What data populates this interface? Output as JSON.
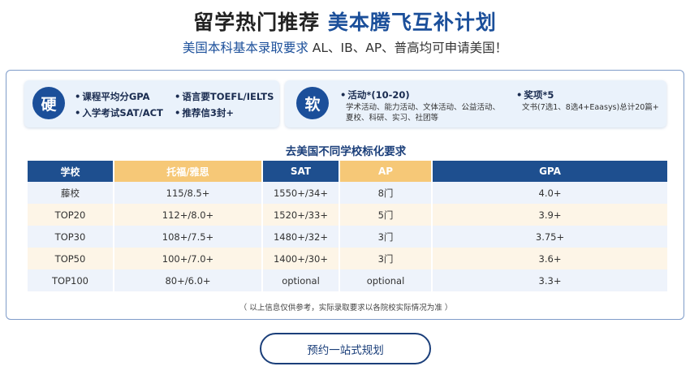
{
  "header": {
    "title_part1": "留学热门推荐",
    "title_part2": "美本腾飞互补计划",
    "subtitle_highlight": "美国本科基本录取要求",
    "subtitle_rest": " AL、IB、AP、普高均可申请美国！"
  },
  "hard": {
    "badge": "硬",
    "items": [
      "课程平均分GPA",
      "入学考试SAT/ACT",
      "语言要TOEFL/IELTS",
      "推荐信3封+"
    ]
  },
  "soft": {
    "badge": "软",
    "activity_title": "活动*(10-20)",
    "activity_line1": "学术活动、能力活动、文体活动、公益活动、",
    "activity_line2": "夏校、科研、实习、社团等",
    "award_title": "奖项*5",
    "award_detail": "文书(7选1、8选4+Eaasys)总计20篇+"
  },
  "table": {
    "title": "去美国不同学校标化要求",
    "headers": [
      "学校",
      "托福/雅思",
      "SAT",
      "AP",
      "GPA"
    ],
    "rows": [
      [
        "藤校",
        "115/8.5+",
        "1550+/34+",
        "8门",
        "4.0+"
      ],
      [
        "TOP20",
        "112+/8.0+",
        "1520+/33+",
        "5门",
        "3.9+"
      ],
      [
        "TOP30",
        "108+/7.5+",
        "1480+/32+",
        "3门",
        "3.75+"
      ],
      [
        "TOP50",
        "100+/7.0+",
        "1400+/30+",
        "3门",
        "3.6+"
      ],
      [
        "TOP100",
        "80+/6.0+",
        "optional",
        "optional",
        "3.3+"
      ]
    ]
  },
  "footnote": "（ 以上信息仅供参考，实际录取要求以各院校实际情况为准 ）",
  "cta": {
    "label": "预约一站式规划"
  },
  "colors": {
    "brand_blue": "#1b4f9a",
    "header_blue": "#1e4f8f",
    "header_gold": "#f6c877"
  }
}
